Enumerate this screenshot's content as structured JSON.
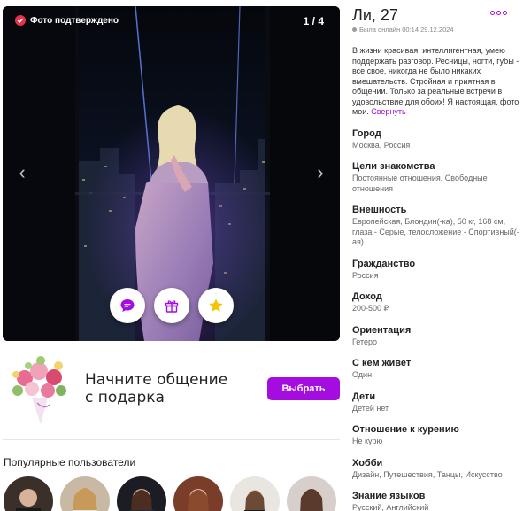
{
  "photo": {
    "verified_label": "Фото подтверждено",
    "counter": "1 / 4",
    "prev_icon": "chevron-left-icon",
    "next_icon": "chevron-right-icon"
  },
  "actions": {
    "chat_icon": "chat-bubble-icon",
    "gift_icon": "gift-icon",
    "favorite_icon": "star-icon",
    "accent_color": "#a40ce0",
    "star_color": "#f5c400"
  },
  "gift": {
    "title_line1": "Начните общение",
    "title_line2": "с подарка",
    "button_label": "Выбрать",
    "button_color": "#a40ce0"
  },
  "popular": {
    "title": "Популярные пользователи"
  },
  "profile": {
    "name": "Ли, 27",
    "online_status": "Была онлайн 00:14 29.12.2024",
    "bio": "В жизни красивая, интеллигентная, умею поддержать разговор. Ресницы, ногти, губы - все свое, никогда не было никаких вмешательств. Стройная и приятная в общении. Только за реальные встречи в удовольствие для обоих! Я настоящая, фото мои.",
    "bio_expand": "Свернуть",
    "fields": [
      {
        "label": "Город",
        "value": "Москва, Россия"
      },
      {
        "label": "Цели знакомства",
        "value": "Постоянные отношения, Свободные отношения"
      },
      {
        "label": "Внешность",
        "value": "Европейская, Блондин(-ка), 50 кг, 168 см, глаза - Серые, телосложение - Спортивный(-ая)"
      },
      {
        "label": "Гражданство",
        "value": "Россия"
      },
      {
        "label": "Доход",
        "value": "200-500 ₽"
      },
      {
        "label": "Ориентация",
        "value": "Гетеро"
      },
      {
        "label": "С кем живет",
        "value": "Один"
      },
      {
        "label": "Дети",
        "value": "Детей нет"
      },
      {
        "label": "Отношение к курению",
        "value": "Не курю"
      },
      {
        "label": "Хобби",
        "value": "Дизайн, Путешествия, Танцы, Искусство"
      },
      {
        "label": "Знание языков",
        "value": "Русский, Английский"
      }
    ]
  }
}
